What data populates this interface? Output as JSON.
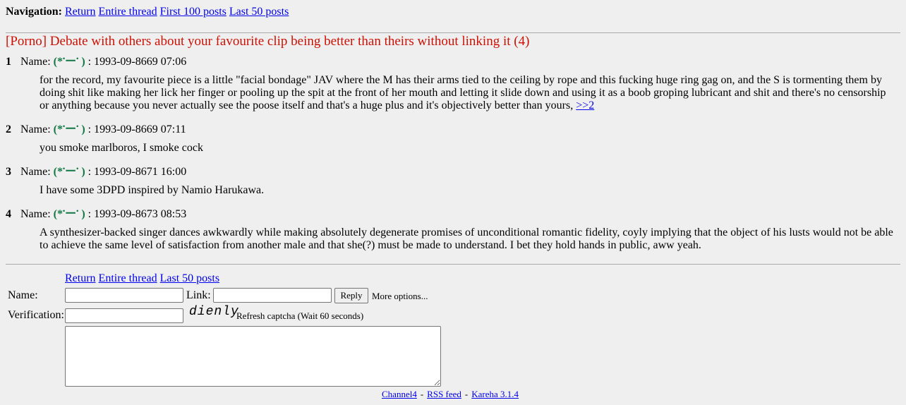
{
  "nav": {
    "label": "Navigation:",
    "links": [
      "Return",
      "Entire thread",
      "First 100 posts",
      "Last 50 posts"
    ]
  },
  "thread": {
    "title": "[Porno] Debate with others about your favourite clip being better than theirs without linking it (4)"
  },
  "name_label": "Name:",
  "poster": {
    "open": "(*",
    "dot1": "•",
    "mid": "ー",
    "dot2": "•",
    "close": ")"
  },
  "posts": [
    {
      "num": "1",
      "date": ": 1993-09-8669 07:06",
      "body": "for the record, my favourite piece is a little \"facial bondage\" JAV where the M has their arms tied to the ceiling by rope and this fucking huge ring gag on, and the S is tormenting them by doing shit like making her lick her finger or pooling up the spit at the front of her mouth and letting it slide down and using it as a boob groping lubricant and shit and there's no censorship or anything because you never actually see the poose itself and that's a huge plus and it's objectively better than yours,",
      "reply_link": ">>2"
    },
    {
      "num": "2",
      "date": ": 1993-09-8669 07:11",
      "body": "you smoke marlboros, I smoke cock"
    },
    {
      "num": "3",
      "date": ": 1993-09-8671 16:00",
      "body": "I have some 3DPD inspired by Namio Harukawa."
    },
    {
      "num": "4",
      "date": ": 1993-09-8673 08:53",
      "body": "A synthesizer-backed singer dances awkwardly while making absolutely degenerate promises of unconditional romantic fidelity, coyly implying that the object of his lusts would not be able to achieve the same level of satisfaction from another male and that she(?) must be made to understand. I bet they hold hands in public, aww yeah."
    }
  ],
  "bottom_nav": {
    "links": [
      "Return",
      "Entire thread",
      "Last 50 posts"
    ]
  },
  "form": {
    "name_label": "Name:",
    "name_value": "",
    "link_label": "Link:",
    "link_value": "",
    "reply_button": "Reply",
    "more_options": "More options...",
    "verification_label": "Verification:",
    "verification_value": "",
    "captcha_text": "dienly",
    "refresh_captcha": "Refresh captcha",
    "wait_text": "(Wait 60 seconds)",
    "message_value": ""
  },
  "footer": {
    "links": [
      "Channel4",
      "RSS feed",
      "Kareha 3.1.4"
    ],
    "separator": "-"
  }
}
